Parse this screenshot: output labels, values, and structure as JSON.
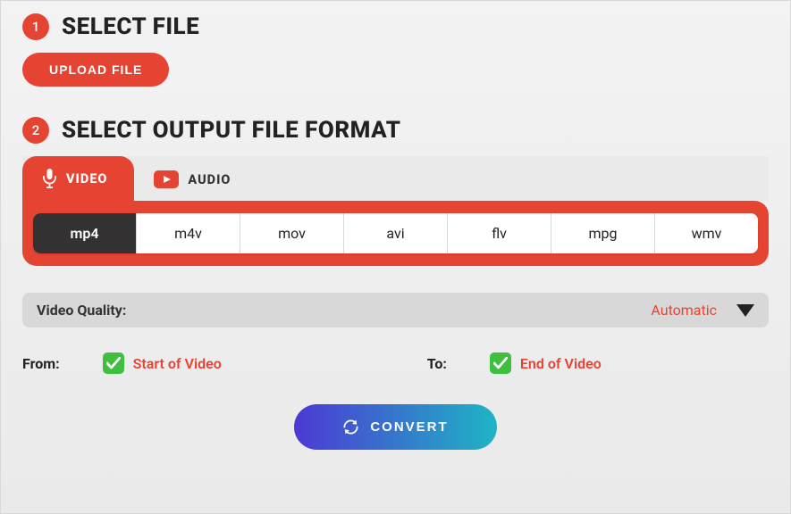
{
  "step1": {
    "num": "1",
    "title": "SELECT FILE",
    "upload": "UPLOAD FILE"
  },
  "step2": {
    "num": "2",
    "title": "SELECT OUTPUT FILE FORMAT"
  },
  "tabs": {
    "video": "VIDEO",
    "audio": "AUDIO"
  },
  "formats": {
    "mp4": "mp4",
    "m4v": "m4v",
    "mov": "mov",
    "avi": "avi",
    "flv": "flv",
    "mpg": "mpg",
    "wmv": "wmv"
  },
  "quality": {
    "label": "Video Quality:",
    "value": "Automatic"
  },
  "trim": {
    "from": "From:",
    "to": "To:",
    "start": "Start of Video",
    "end": "End of Video"
  },
  "convert": "CONVERT"
}
